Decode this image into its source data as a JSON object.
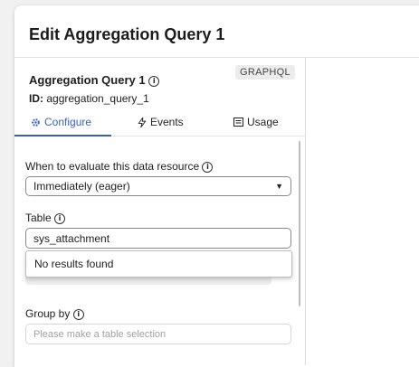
{
  "dialog": {
    "title": "Edit Aggregation Query 1"
  },
  "resource": {
    "name": "Aggregation Query 1",
    "id_label": "ID:",
    "id_value": "aggregation_query_1",
    "badge": "GRAPHQL"
  },
  "tabs": [
    {
      "label": "Configure",
      "icon": "gear-icon",
      "active": true
    },
    {
      "label": "Events",
      "icon": "bolt-icon",
      "active": false
    },
    {
      "label": "Usage",
      "icon": "list-icon",
      "active": false
    }
  ],
  "evaluate": {
    "label": "When to evaluate this data resource",
    "value": "Immediately (eager)"
  },
  "table": {
    "label": "Table",
    "value": "sys_attachment",
    "dropdown_message": "No results found"
  },
  "group_by": {
    "label": "Group by",
    "placeholder": "Please make a table selection"
  },
  "colors": {
    "accent": "#3a5fbf"
  }
}
